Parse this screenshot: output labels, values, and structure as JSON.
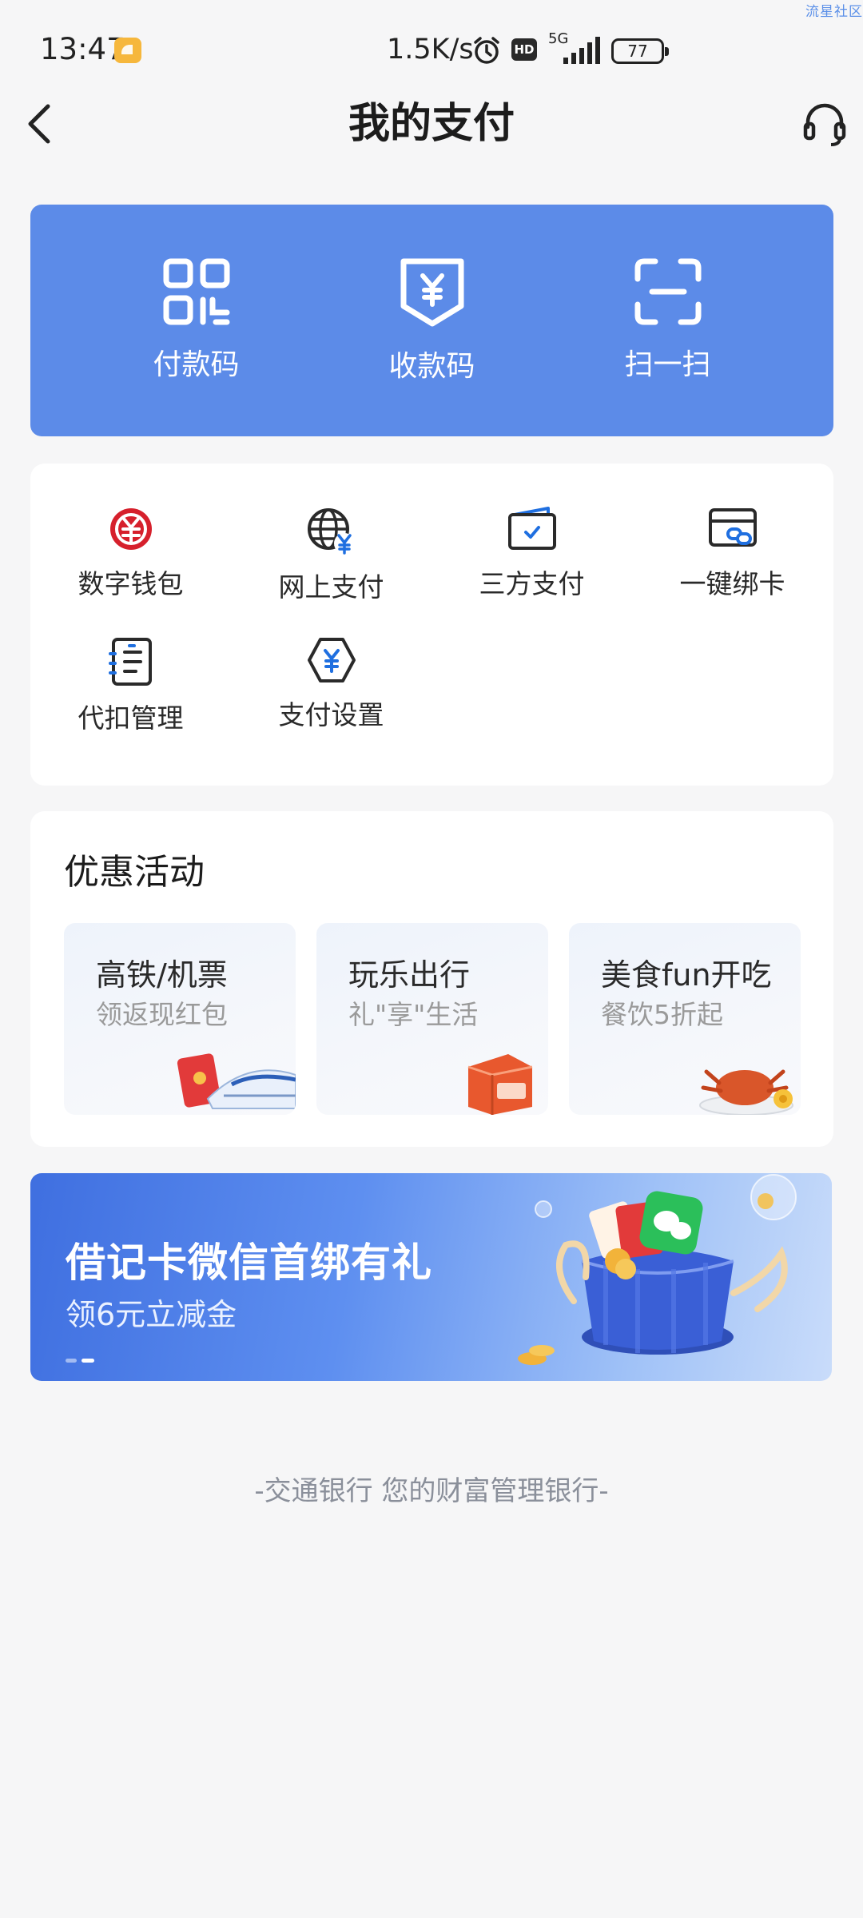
{
  "watermark": "流星社区",
  "status_bar": {
    "time": "13:47",
    "net_speed": "1.5K/s",
    "hd_badge": "HD",
    "network": "5G",
    "battery": "77"
  },
  "header": {
    "title": "我的支付",
    "back_icon": "chevron-left-icon",
    "service_icon": "headset-icon"
  },
  "pay_card": {
    "accent_color": "#5c8be8",
    "items": [
      {
        "label": "付款码",
        "icon": "qr-code-icon"
      },
      {
        "label": "收款码",
        "icon": "yuan-shield-icon"
      },
      {
        "label": "扫一扫",
        "icon": "scan-icon"
      }
    ]
  },
  "functions": {
    "items": [
      {
        "label": "数字钱包",
        "icon": "digital-yuan-icon"
      },
      {
        "label": "网上支付",
        "icon": "globe-yuan-icon"
      },
      {
        "label": "三方支付",
        "icon": "wallet-check-icon"
      },
      {
        "label": "一键绑卡",
        "icon": "card-link-icon"
      },
      {
        "label": "代扣管理",
        "icon": "list-document-icon"
      },
      {
        "label": "支付设置",
        "icon": "hexagon-yuan-icon"
      }
    ]
  },
  "promotions": {
    "title": "优惠活动",
    "tiles": [
      {
        "title": "高铁/机票",
        "subtitle": "领返现红包"
      },
      {
        "title": "玩乐出行",
        "subtitle": "礼\"享\"生活"
      },
      {
        "title": "美食fun开吃",
        "subtitle": "餐饮5折起"
      }
    ]
  },
  "banner": {
    "title": "借记卡微信首绑有礼",
    "subtitle": "领6元立减金"
  },
  "footer": {
    "slogan": "-交通银行 您的财富管理银行-"
  }
}
